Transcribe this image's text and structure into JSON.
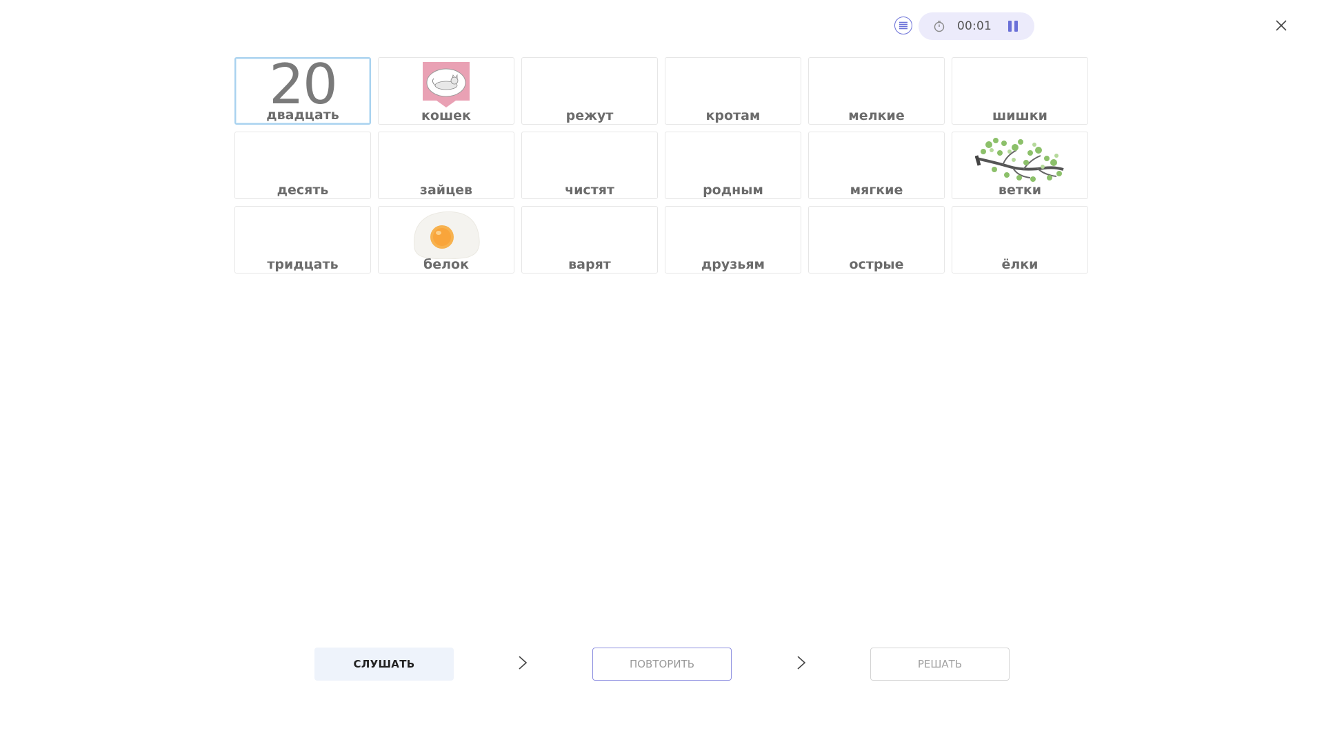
{
  "header": {
    "menu_icon": "list-icon",
    "timer_icon": "stopwatch-icon",
    "timer_value": "00:01",
    "pause_icon": "pause-icon",
    "close_icon": "close-icon",
    "accent_color": "#6a70d8",
    "pill_color": "#ecebfb"
  },
  "cards": [
    {
      "label": "двадцать",
      "image_text": "20",
      "selected": true
    },
    {
      "label": "кошек",
      "image": "cat-sticker"
    },
    {
      "label": "режут"
    },
    {
      "label": "кротам"
    },
    {
      "label": "мелкие"
    },
    {
      "label": "шишки"
    },
    {
      "label": "десять"
    },
    {
      "label": "зайцев"
    },
    {
      "label": "чистят"
    },
    {
      "label": "родным"
    },
    {
      "label": "мягкие"
    },
    {
      "label": "ветки",
      "image": "tree-branch"
    },
    {
      "label": "тридцать"
    },
    {
      "label": "белок",
      "image": "fried-egg"
    },
    {
      "label": "варят"
    },
    {
      "label": "друзьям"
    },
    {
      "label": "острые"
    },
    {
      "label": "ёлки"
    }
  ],
  "footer": {
    "listen_label": "СЛУШАТЬ",
    "repeat_label": "ПОВТОРИТЬ",
    "solve_label": "РЕШАТЬ",
    "arrow_icon": "chevron-right-icon"
  }
}
